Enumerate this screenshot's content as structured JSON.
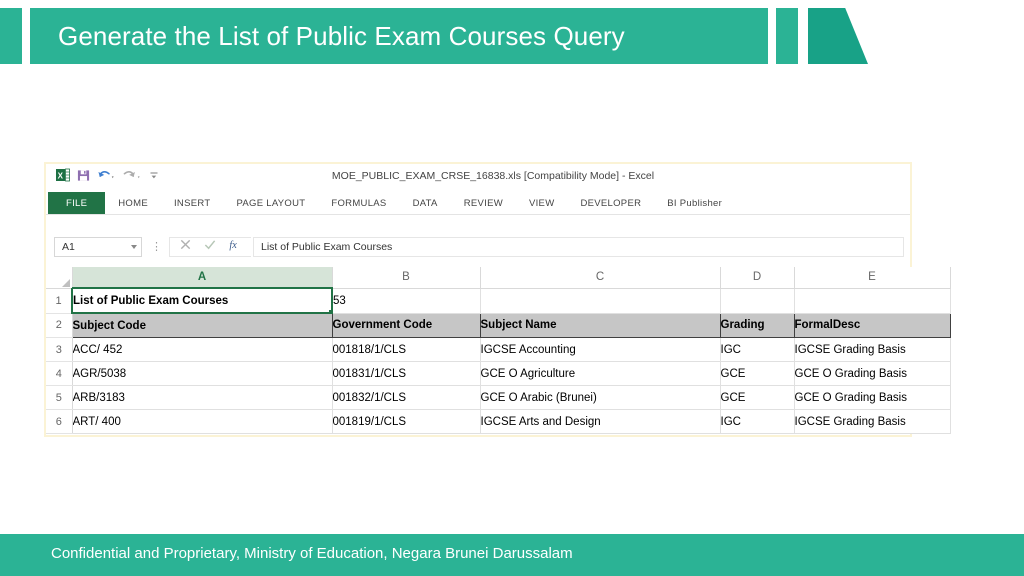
{
  "slide": {
    "title": "Generate the List of Public Exam Courses Query",
    "footer_text": "Confidential and Proprietary, Ministry of Education, Negara Brunei Darussalam",
    "accent_color": "#2bb395",
    "accent_dark_color": "#18a287"
  },
  "excel": {
    "document_title": "MOE_PUBLIC_EXAM_CRSE_16838.xls  [Compatibility Mode] - Excel",
    "quick_access": [
      {
        "name": "excel-logo-icon",
        "label": "Excel"
      },
      {
        "name": "save-icon",
        "label": "Save"
      },
      {
        "name": "undo-icon",
        "label": "Undo"
      },
      {
        "name": "redo-icon",
        "label": "Redo"
      },
      {
        "name": "customize-quick-access-toolbar-icon",
        "label": "Customize Quick Access Toolbar"
      }
    ],
    "ribbon_tabs": [
      {
        "label": "FILE",
        "active": true
      },
      {
        "label": "HOME",
        "active": false
      },
      {
        "label": "INSERT",
        "active": false
      },
      {
        "label": "PAGE LAYOUT",
        "active": false
      },
      {
        "label": "FORMULAS",
        "active": false
      },
      {
        "label": "DATA",
        "active": false
      },
      {
        "label": "REVIEW",
        "active": false
      },
      {
        "label": "VIEW",
        "active": false
      },
      {
        "label": "DEVELOPER",
        "active": false
      },
      {
        "label": "BI Publisher",
        "active": false
      }
    ],
    "formula_bar": {
      "name_box_value": "A1",
      "cancel_label": "Cancel",
      "enter_label": "Enter",
      "insert_function_label": "fx",
      "formula_value": "List of Public Exam Courses"
    },
    "grid": {
      "column_headers": [
        "A",
        "B",
        "C",
        "D",
        "E"
      ],
      "selected_column": "A",
      "selected_cell": "A1",
      "rows": [
        {
          "number": "1",
          "cells": [
            "List of Public Exam Courses",
            "53",
            "",
            "",
            ""
          ],
          "style": "normal"
        },
        {
          "number": "2",
          "cells": [
            "Subject Code",
            "Government Code",
            "Subject Name",
            "Grading",
            "FormalDesc"
          ],
          "style": "header"
        },
        {
          "number": "3",
          "cells": [
            "ACC/ 452",
            "001818/1/CLS",
            "IGCSE Accounting",
            "IGC",
            "IGCSE Grading Basis"
          ],
          "style": "normal"
        },
        {
          "number": "4",
          "cells": [
            "AGR/5038",
            "001831/1/CLS",
            "GCE O Agriculture",
            "GCE",
            "GCE O Grading Basis"
          ],
          "style": "normal"
        },
        {
          "number": "5",
          "cells": [
            "ARB/3183",
            "001832/1/CLS",
            "GCE O Arabic (Brunei)",
            "GCE",
            "GCE O Grading Basis"
          ],
          "style": "normal"
        },
        {
          "number": "6",
          "cells": [
            "ART/ 400",
            "001819/1/CLS",
            "IGCSE Arts and Design",
            "IGC",
            "IGCSE Grading Basis"
          ],
          "style": "normal"
        }
      ]
    }
  }
}
